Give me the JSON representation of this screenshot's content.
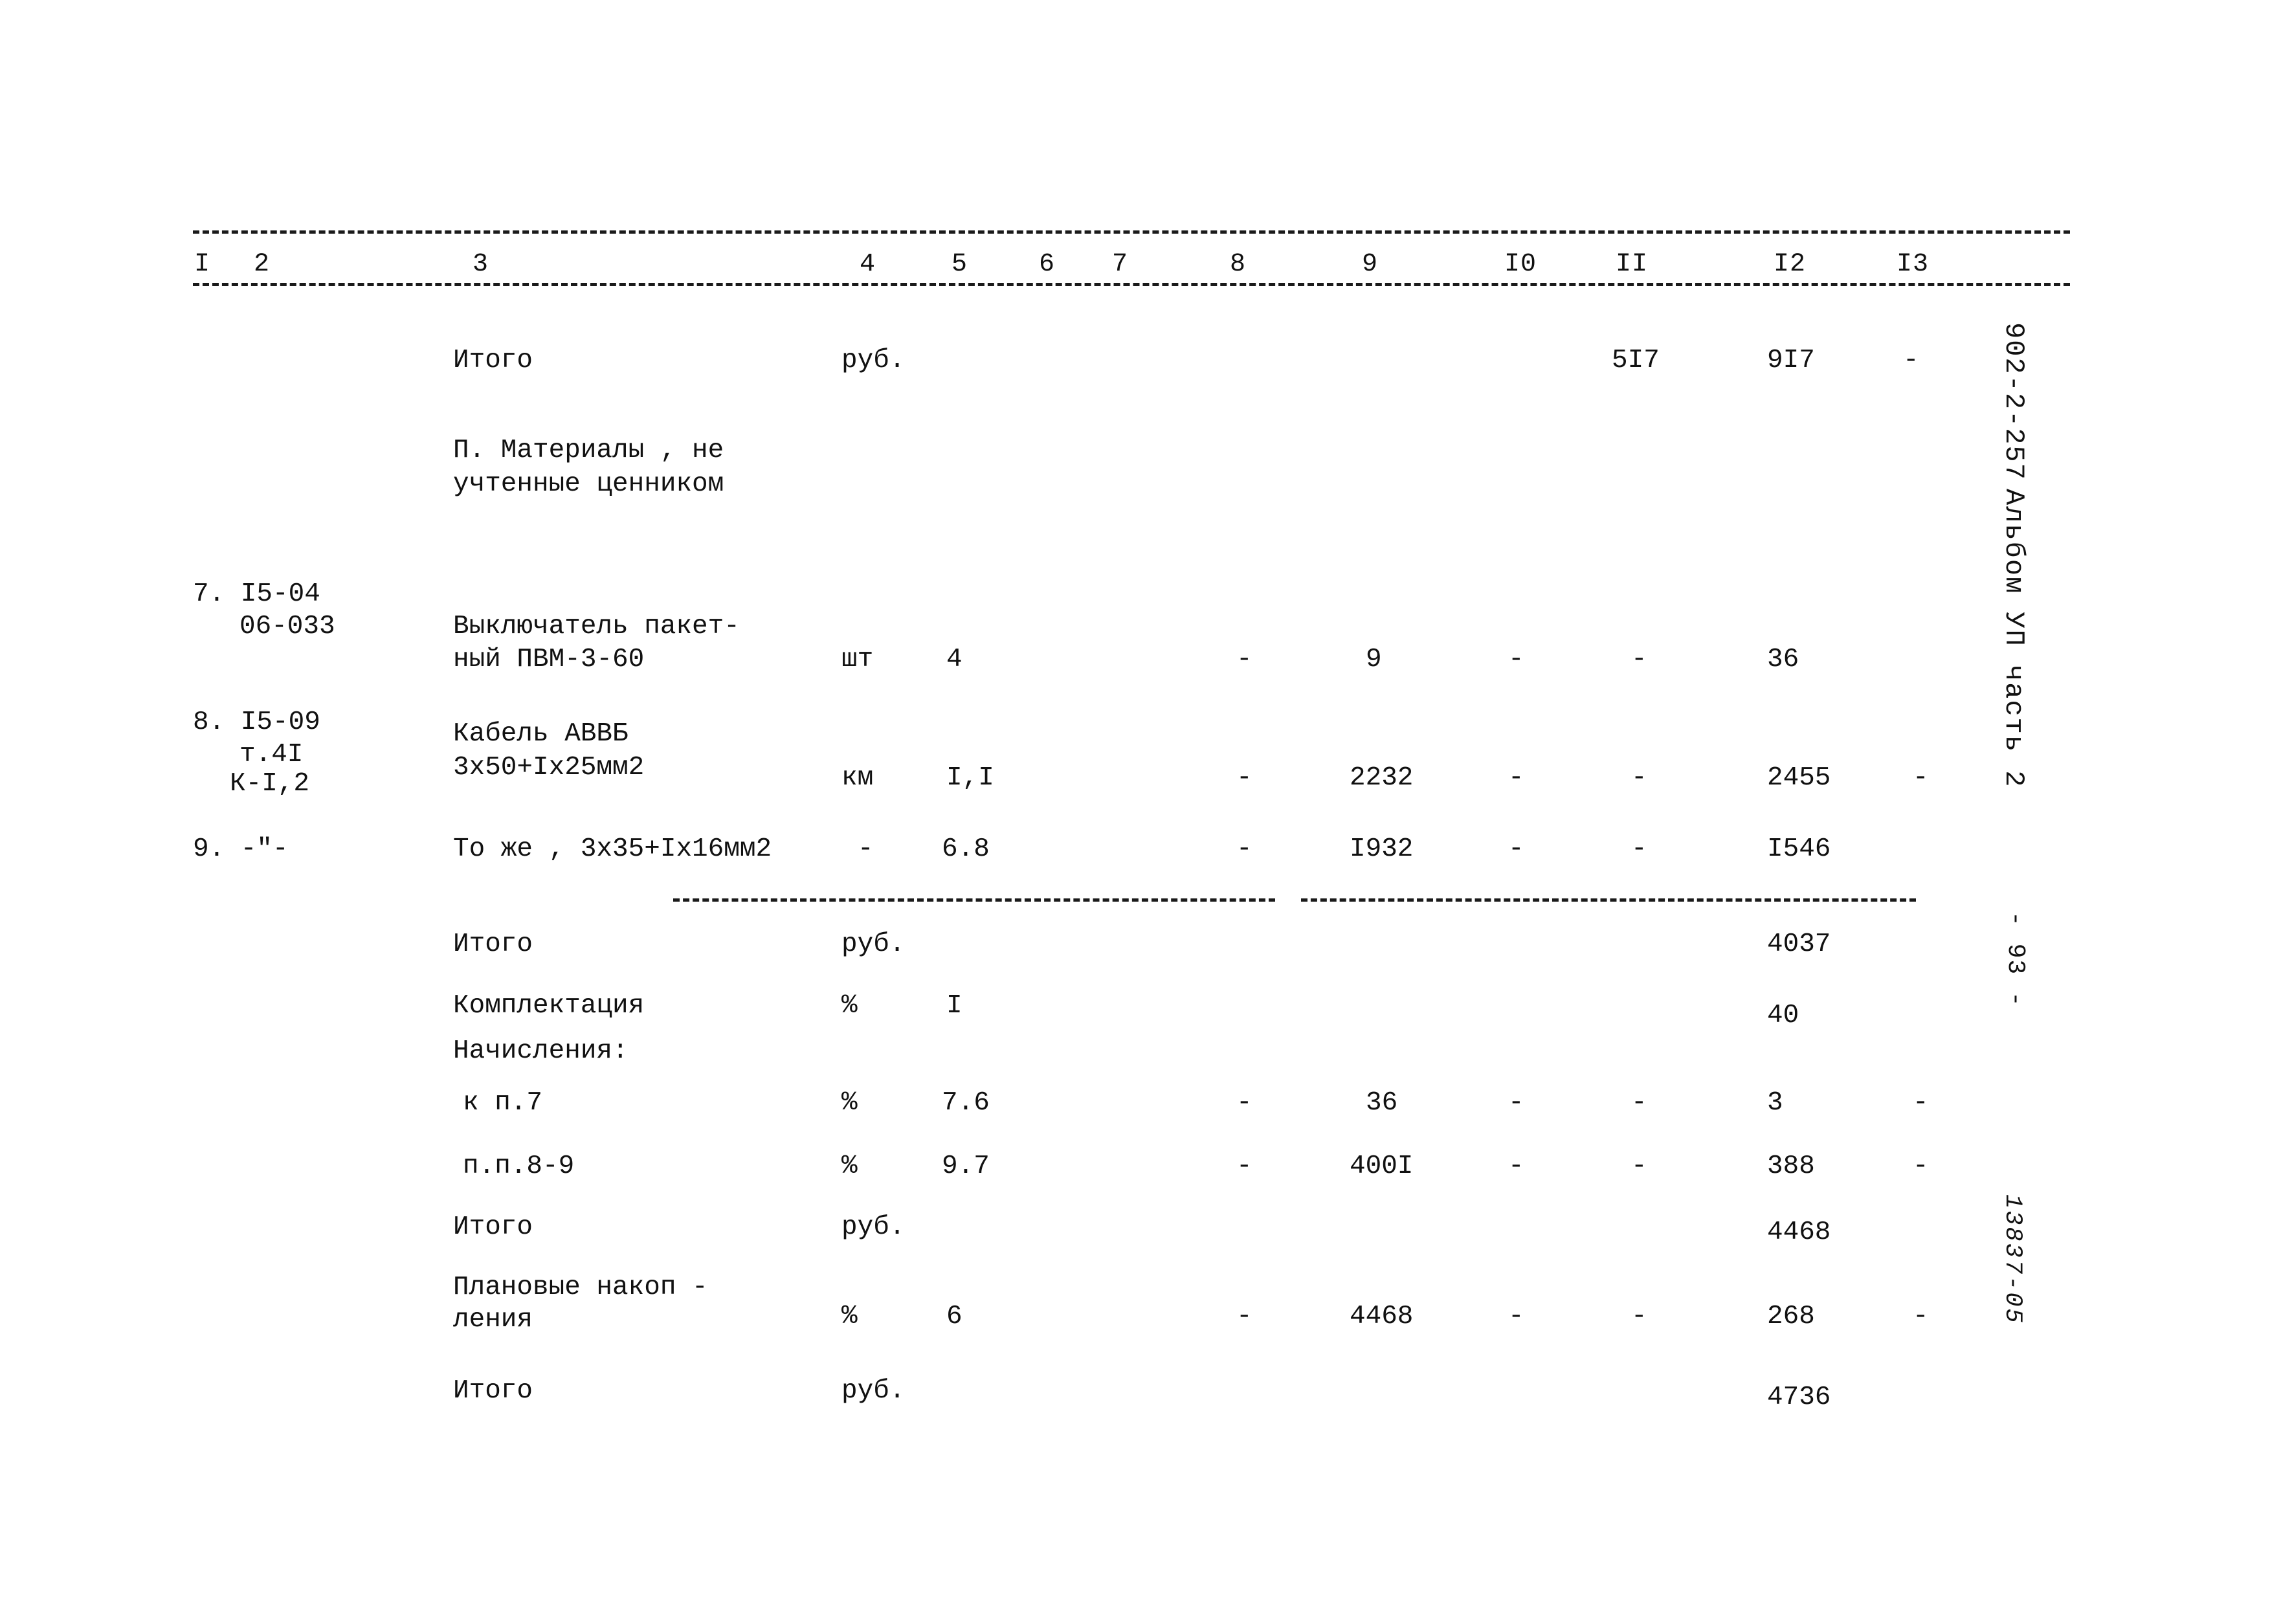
{
  "page": {
    "sheet_code": "902-2-257",
    "album": "Альбом  УП  часть 2",
    "page_number": "- 93 -",
    "archive_code": "13837-05"
  },
  "table": {
    "column_numbers": [
      "I",
      "2",
      "3",
      "4",
      "5",
      "6",
      "7",
      "8",
      "9",
      "I0",
      "II",
      "I2",
      "I3"
    ],
    "rows": [
      {
        "name": "row-itogo-1",
        "col1": "",
        "col2": "",
        "col3": "Итого",
        "col4": "руб.",
        "col5": "",
        "col8": "",
        "col9": "",
        "col10": "",
        "col11": "5I7",
        "col12": "9I7",
        "col13": "-"
      },
      {
        "name": "row-section-title",
        "col3_line1": "П. Материалы , не",
        "col3_line2": "учтенные ценником"
      },
      {
        "name": "row-7",
        "col1_line1": "7. I5-04",
        "col1_line2": "06-033",
        "col3_line1": "Выключатель пакет-",
        "col3_line2": "ный ПВМ-3-60",
        "col4": "шт",
        "col5": "4",
        "col8": "-",
        "col9": "9",
        "col10": "-",
        "col11": "-",
        "col12": "36",
        "col13": ""
      },
      {
        "name": "row-8",
        "col1_line1": "8. I5-09",
        "col1_line2": "т.4I",
        "col1_line3": "К-I,2",
        "col3_line1": "Кабель АВВБ",
        "col3_line2": "3х50+Iх25мм2",
        "col4": "км",
        "col5": "I,I",
        "col8": "-",
        "col9": "2232",
        "col10": "-",
        "col11": "-",
        "col12": "2455",
        "col13": "-"
      },
      {
        "name": "row-9",
        "col1": "9. -\"-",
        "col3": "То же , 3х35+Iх16мм2",
        "col4": "-",
        "col5": "6.8",
        "col8": "-",
        "col9": "I932",
        "col10": "-",
        "col11": "-",
        "col12": "I546",
        "col13": ""
      },
      {
        "name": "row-itogo-2",
        "col3": "Итого",
        "col4": "руб.",
        "col12": "4037"
      },
      {
        "name": "row-komplektaciya",
        "col3": "Комплектация",
        "col4": "%",
        "col5": "I",
        "col12": "40"
      },
      {
        "name": "row-nachisleniya-header",
        "col3": "Начисления:"
      },
      {
        "name": "row-k-p7",
        "col3": "к п.7",
        "col4": "%",
        "col5": "7.6",
        "col8": "-",
        "col9": "36",
        "col10": "-",
        "col11": "-",
        "col12": "3",
        "col13": "-"
      },
      {
        "name": "row-pp8-9",
        "col3": "п.п.8-9",
        "col4": "%",
        "col5": "9.7",
        "col8": "-",
        "col9": "400I",
        "col10": "-",
        "col11": "-",
        "col12": "388",
        "col13": "-"
      },
      {
        "name": "row-itogo-3",
        "col3": "Итого",
        "col4": "руб.",
        "col12": "4468"
      },
      {
        "name": "row-planovye",
        "col3_line1": "Плановые накоп -",
        "col3_line2": "ления",
        "col4": "%",
        "col5": "6",
        "col8": "-",
        "col9": "4468",
        "col10": "-",
        "col11": "-",
        "col12": "268",
        "col13": "-"
      },
      {
        "name": "row-itogo-4",
        "col3": "Итого",
        "col4": "руб.",
        "col12": "4736"
      }
    ]
  }
}
